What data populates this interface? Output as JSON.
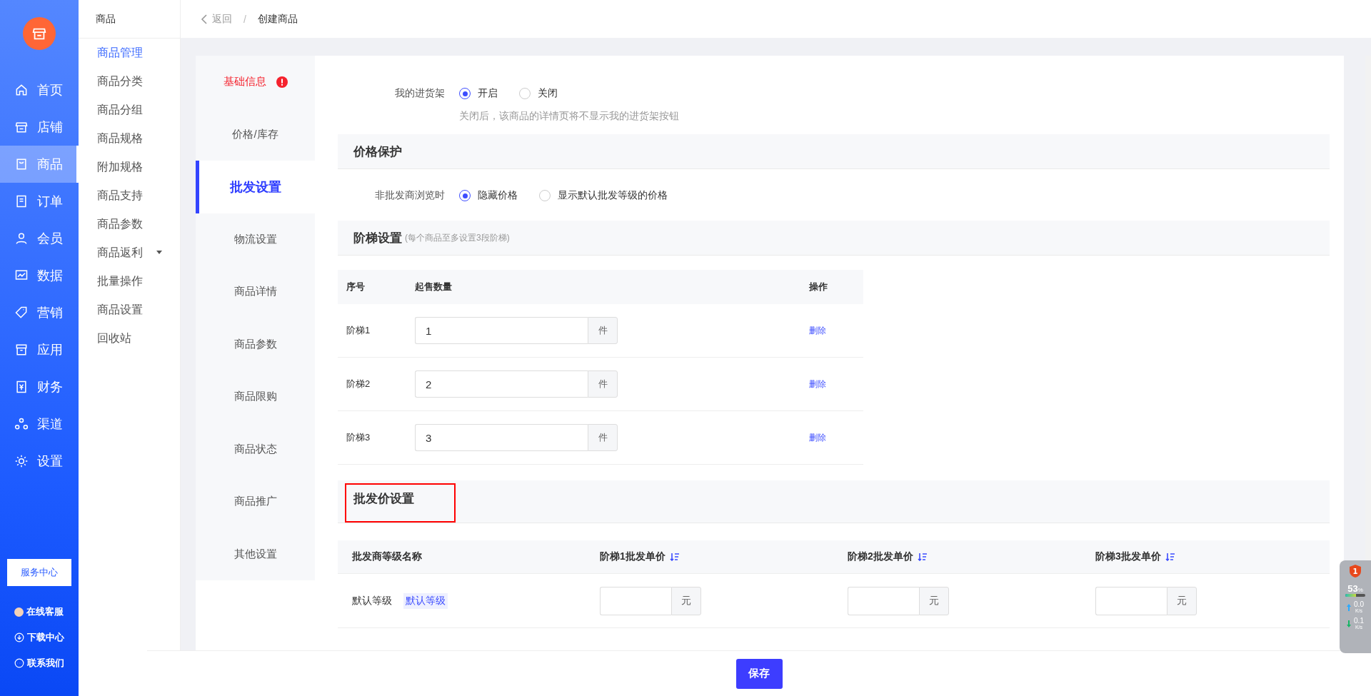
{
  "sidebar": {
    "nav": [
      {
        "label": "首页",
        "selected": false
      },
      {
        "label": "店铺",
        "selected": false
      },
      {
        "label": "商品",
        "selected": true
      },
      {
        "label": "订单",
        "selected": false
      },
      {
        "label": "会员",
        "selected": false
      },
      {
        "label": "数据",
        "selected": false
      },
      {
        "label": "营销",
        "selected": false
      },
      {
        "label": "应用",
        "selected": false
      },
      {
        "label": "财务",
        "selected": false
      },
      {
        "label": "渠道",
        "selected": false
      },
      {
        "label": "设置",
        "selected": false
      }
    ],
    "service_button": "服务中心",
    "links": [
      {
        "label": "在线客服"
      },
      {
        "label": "下载中心"
      },
      {
        "label": "联系我们"
      }
    ]
  },
  "subnav": {
    "title": "商品",
    "items": [
      {
        "label": "商品管理",
        "selected": true,
        "kind": "link"
      },
      {
        "label": "商品分类",
        "selected": false,
        "kind": "link"
      },
      {
        "label": "商品分组",
        "selected": false,
        "kind": "link"
      },
      {
        "label": "商品规格",
        "selected": false,
        "kind": "link"
      },
      {
        "label": "附加规格",
        "selected": false,
        "kind": "link"
      },
      {
        "label": "商品支持",
        "selected": false,
        "kind": "link"
      },
      {
        "label": "商品参数",
        "selected": false,
        "kind": "link"
      },
      {
        "label": "商品返利",
        "selected": false,
        "kind": "group"
      },
      {
        "label": "批量操作",
        "selected": false,
        "kind": "link"
      },
      {
        "label": "商品设置",
        "selected": false,
        "kind": "link"
      },
      {
        "label": "回收站",
        "selected": false,
        "kind": "link"
      }
    ]
  },
  "breadcrumb": {
    "back": "返回",
    "separator": "/",
    "current": "创建商品"
  },
  "tabs": [
    {
      "label": "基础信息",
      "selected": false,
      "error": true
    },
    {
      "label": "价格/库存",
      "selected": false,
      "error": false
    },
    {
      "label": "批发设置",
      "selected": true,
      "error": false
    },
    {
      "label": "物流设置",
      "selected": false,
      "error": false
    },
    {
      "label": "商品详情",
      "selected": false,
      "error": false
    },
    {
      "label": "商品参数",
      "selected": false,
      "error": false
    },
    {
      "label": "商品限购",
      "selected": false,
      "error": false
    },
    {
      "label": "商品状态",
      "selected": false,
      "error": false
    },
    {
      "label": "商品推广",
      "selected": false,
      "error": false
    },
    {
      "label": "其他设置",
      "selected": false,
      "error": false
    }
  ],
  "shelf": {
    "label": "我的进货架",
    "options": [
      {
        "label": "开启",
        "selected": true
      },
      {
        "label": "关闭",
        "selected": false
      }
    ],
    "hint": "关闭后，该商品的详情页将不显示我的进货架按钮"
  },
  "price_protection": {
    "title": "价格保护",
    "label": "非批发商浏览时",
    "options": [
      {
        "label": "隐藏价格",
        "selected": true
      },
      {
        "label": "显示默认批发等级的价格",
        "selected": false
      }
    ]
  },
  "tiers": {
    "title": "阶梯设置",
    "note": "(每个商品至多设置3段阶梯)",
    "columns": [
      "序号",
      "起售数量",
      "操作"
    ],
    "rows": [
      {
        "name": "阶梯1",
        "value": "1",
        "unit": "件",
        "action": "删除"
      },
      {
        "name": "阶梯2",
        "value": "2",
        "unit": "件",
        "action": "删除"
      },
      {
        "name": "阶梯3",
        "value": "3",
        "unit": "件",
        "action": "删除"
      }
    ]
  },
  "wholesale": {
    "title": "批发价设置",
    "highlighted": true,
    "columns": [
      {
        "label": "批发商等级名称",
        "sortable": false
      },
      {
        "label": "阶梯1批发单价",
        "sortable": true
      },
      {
        "label": "阶梯2批发单价",
        "sortable": true
      },
      {
        "label": "阶梯3批发单价",
        "sortable": true
      }
    ],
    "rows": [
      {
        "name": "默认等级",
        "tag": "默认等级",
        "cells": [
          {
            "unit": "元"
          },
          {
            "unit": "元"
          },
          {
            "unit": "元"
          }
        ]
      }
    ]
  },
  "save_button": "保存",
  "monitor": {
    "badge": "1",
    "percent": "53",
    "percent_unit": "%",
    "level": 0.53,
    "rates": [
      {
        "kind": "upload",
        "value": "0.0",
        "unit": "K/s"
      },
      {
        "kind": "download",
        "value": "0.1",
        "unit": "K/s"
      }
    ]
  }
}
